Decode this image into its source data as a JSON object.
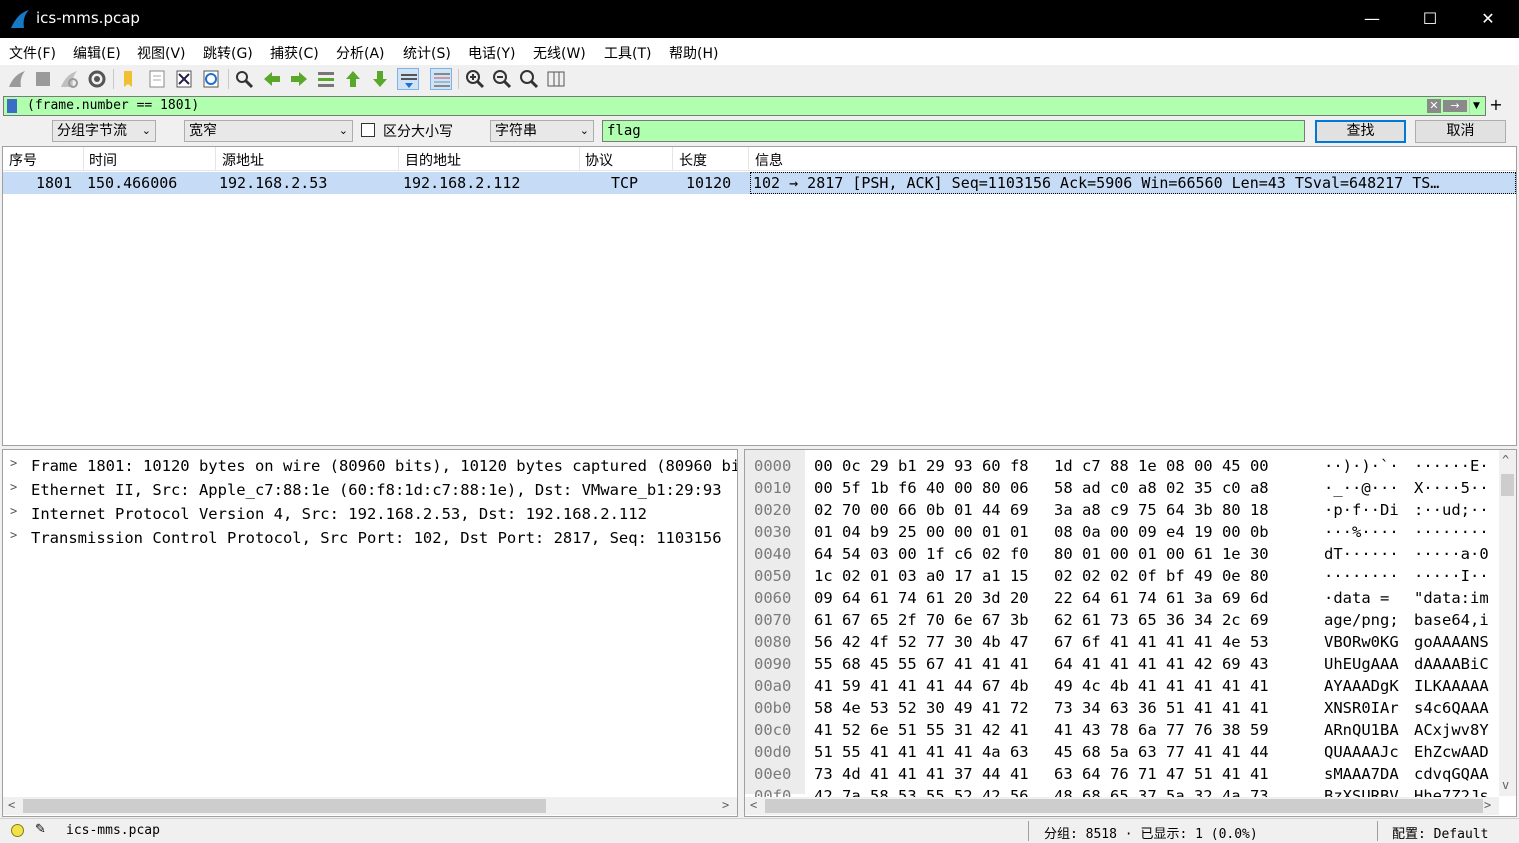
{
  "window": {
    "title": "ics-mms.pcap",
    "minimize": "—",
    "maximize": "☐",
    "close": "✕"
  },
  "menu": [
    "文件(F)",
    "编辑(E)",
    "视图(V)",
    "跳转(G)",
    "捕获(C)",
    "分析(A)",
    "统计(S)",
    "电话(Y)",
    "无线(W)",
    "工具(T)",
    "帮助(H)"
  ],
  "toolbar": {
    "buttons": [
      "start-capture",
      "stop-capture",
      "restart-capture",
      "capture-options",
      "open-file",
      "save-file",
      "close-file",
      "reload-file",
      "find-packet",
      "go-back",
      "go-forward",
      "go-to-packet",
      "first-packet",
      "last-packet",
      "auto-scroll",
      "colorize",
      "zoom-in",
      "zoom-out",
      "normal-size",
      "resize-columns"
    ]
  },
  "filter": {
    "value": "(frame.number == 1801)",
    "bg_color": "#afffaf"
  },
  "search": {
    "scope": "分组字节流",
    "charset": "宽窄",
    "case_label": "区分大小写",
    "case_checked": false,
    "type": "字符串",
    "value": "flag",
    "find_label": "查找",
    "cancel_label": "取消"
  },
  "packet_list": {
    "columns": [
      "序号",
      "时间",
      "源地址",
      "目的地址",
      "协议",
      "长度",
      "信息"
    ],
    "rows": [
      {
        "no": "1801",
        "time": "150.466006",
        "source": "192.168.2.53",
        "destination": "192.168.2.112",
        "protocol": "TCP",
        "length": "10120",
        "info": "102 → 2817 [PSH, ACK] Seq=1103156 Ack=5906 Win=66560 Len=43 TSval=648217 TS…"
      }
    ],
    "selected_color": "#c6dbf6"
  },
  "details": [
    "Frame 1801: 10120 bytes on wire (80960 bits), 10120 bytes captured (80960 bits)",
    "Ethernet II, Src: Apple_c7:88:1e (60:f8:1d:c7:88:1e), Dst: VMware_b1:29:93",
    "Internet Protocol Version 4, Src: 192.168.2.53, Dst: 192.168.2.112",
    "Transmission Control Protocol, Src Port: 102, Dst Port: 2817, Seq: 1103156"
  ],
  "hex": [
    {
      "off": "0000",
      "b1": "00 0c 29 b1 29 93 60 f8",
      "b2": "1d c7 88 1e 08 00 45 00",
      "a1": "··)·)·`·",
      "a2": "······E·"
    },
    {
      "off": "0010",
      "b1": "00 5f 1b f6 40 00 80 06",
      "b2": "58 ad c0 a8 02 35 c0 a8",
      "a1": "·_··@···",
      "a2": "X····5··"
    },
    {
      "off": "0020",
      "b1": "02 70 00 66 0b 01 44 69",
      "b2": "3a a8 c9 75 64 3b 80 18",
      "a1": "·p·f··Di",
      "a2": ":··ud;··"
    },
    {
      "off": "0030",
      "b1": "01 04 b9 25 00 00 01 01",
      "b2": "08 0a 00 09 e4 19 00 0b",
      "a1": "···%····",
      "a2": "········"
    },
    {
      "off": "0040",
      "b1": "64 54 03 00 1f c6 02 f0",
      "b2": "80 01 00 01 00 61 1e 30",
      "a1": "dT······",
      "a2": "·····a·0"
    },
    {
      "off": "0050",
      "b1": "1c 02 01 03 a0 17 a1 15",
      "b2": "02 02 02 0f bf 49 0e 80",
      "a1": "········",
      "a2": "·····I··"
    },
    {
      "off": "0060",
      "b1": "09 64 61 74 61 20 3d 20",
      "b2": "22 64 61 74 61 3a 69 6d",
      "a1": "·data = ",
      "a2": "\"data:im"
    },
    {
      "off": "0070",
      "b1": "61 67 65 2f 70 6e 67 3b",
      "b2": "62 61 73 65 36 34 2c 69",
      "a1": "age/png;",
      "a2": "base64,i"
    },
    {
      "off": "0080",
      "b1": "56 42 4f 52 77 30 4b 47",
      "b2": "67 6f 41 41 41 41 4e 53",
      "a1": "VBORw0KG",
      "a2": "goAAAANS"
    },
    {
      "off": "0090",
      "b1": "55 68 45 55 67 41 41 41",
      "b2": "64 41 41 41 41 42 69 43",
      "a1": "UhEUgAAA",
      "a2": "dAAAABiC"
    },
    {
      "off": "00a0",
      "b1": "41 59 41 41 41 44 67 4b",
      "b2": "49 4c 4b 41 41 41 41 41",
      "a1": "AYAAADgK",
      "a2": "ILKAAAAA"
    },
    {
      "off": "00b0",
      "b1": "58 4e 53 52 30 49 41 72",
      "b2": "73 34 63 36 51 41 41 41",
      "a1": "XNSR0IAr",
      "a2": "s4c6QAAA"
    },
    {
      "off": "00c0",
      "b1": "41 52 6e 51 55 31 42 41",
      "b2": "41 43 78 6a 77 76 38 59",
      "a1": "ARnQU1BA",
      "a2": "ACxjwv8Y"
    },
    {
      "off": "00d0",
      "b1": "51 55 41 41 41 41 4a 63",
      "b2": "45 68 5a 63 77 41 41 44",
      "a1": "QUAAAAJc",
      "a2": "EhZcwAAD"
    },
    {
      "off": "00e0",
      "b1": "73 4d 41 41 41 37 44 41",
      "b2": "63 64 76 71 47 51 41 41",
      "a1": "sMAAA7DA",
      "a2": "cdvqGQAA"
    },
    {
      "off": "00f0",
      "b1": "42 7a 58 53 55 52 42 56",
      "b2": "48 68 65 37 5a 32 4a 73",
      "a1": "BzXSURBV",
      "a2": "Hhe7Z2Js"
    }
  ],
  "status": {
    "file": "ics-mms.pcap",
    "packets": "分组: 8518 · 已显示: 1 (0.0%)",
    "profile": "配置: Default",
    "led_color": "#f2e24a"
  }
}
